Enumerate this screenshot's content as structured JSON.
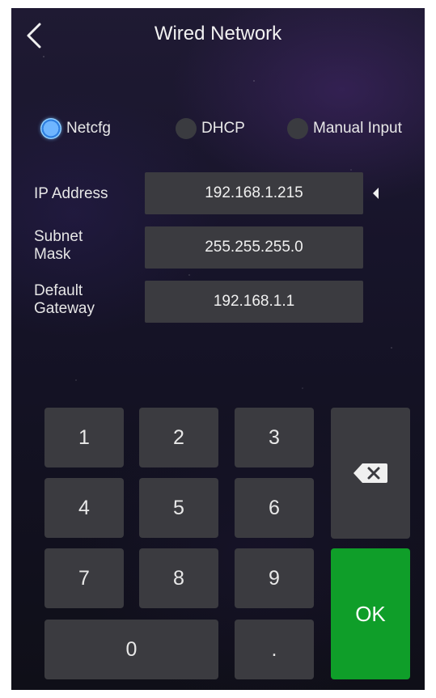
{
  "header": {
    "title": "Wired Network",
    "back_icon": "chevron-left-icon"
  },
  "network_mode": {
    "options": [
      {
        "label": "Netcfg",
        "selected": true
      },
      {
        "label": "DHCP",
        "selected": false
      },
      {
        "label": "Manual Input",
        "selected": false
      }
    ]
  },
  "fields": {
    "ip": {
      "label": "IP Address",
      "value": "192.168.1.215"
    },
    "subnet": {
      "label_line1": "Subnet",
      "label_line2": "Mask",
      "value": "255.255.255.0"
    },
    "gateway": {
      "label_line1": "Default",
      "label_line2": "Gateway",
      "value": "192.168.1.1"
    }
  },
  "keypad": {
    "k1": "1",
    "k2": "2",
    "k3": "3",
    "k4": "4",
    "k5": "5",
    "k6": "6",
    "k7": "7",
    "k8": "8",
    "k9": "9",
    "k0": "0",
    "dot": ".",
    "ok": "OK",
    "backspace_icon": "backspace-icon"
  },
  "colors": {
    "accent_blue": "#4aa3ff",
    "ok_green": "#0f9e29",
    "field_bg": "#3b3b40"
  }
}
